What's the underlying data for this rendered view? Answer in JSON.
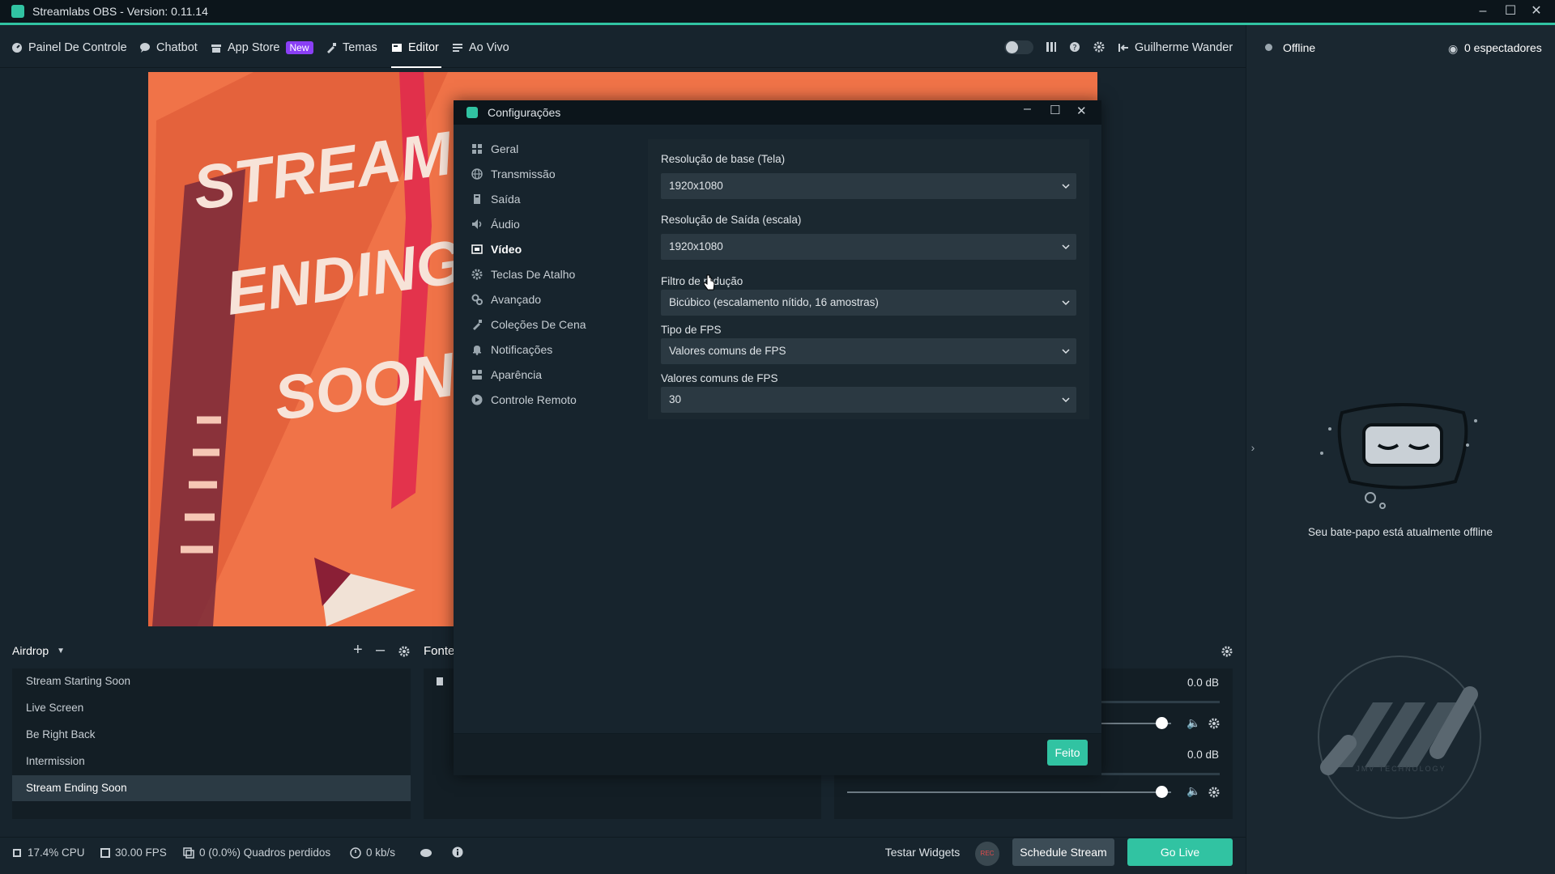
{
  "window": {
    "title": "Streamlabs OBS - Version: 0.11.14"
  },
  "nav": {
    "items": [
      {
        "label": "Painel De Controle"
      },
      {
        "label": "Chatbot"
      },
      {
        "label": "App Store",
        "badge": "New"
      },
      {
        "label": "Temas"
      },
      {
        "label": "Editor"
      },
      {
        "label": "Ao Vivo"
      }
    ],
    "user": "Guilherme Wander"
  },
  "chat": {
    "status": "Offline",
    "viewers": "0 espectadores",
    "offline_message": "Seu bate-papo está atualmente offline",
    "watermark_text": "JMV TECHNOLOGY"
  },
  "scenes": {
    "collection": "Airdrop",
    "items": [
      {
        "label": "Stream Starting Soon"
      },
      {
        "label": "Live Screen"
      },
      {
        "label": "Be Right Back"
      },
      {
        "label": "Intermission"
      },
      {
        "label": "Stream Ending Soon"
      }
    ],
    "active_index": 4
  },
  "sources": {
    "header": "Fonte"
  },
  "mixer": {
    "channels": [
      {
        "db": "0.0 dB",
        "level": 0.97
      },
      {
        "db": "0.0 dB",
        "level": 0.97
      }
    ]
  },
  "status": {
    "cpu": "17.4% CPU",
    "fps": "30.00 FPS",
    "frames": "0 (0.0%) Quadros perdidos",
    "bitrate": "0 kb/s"
  },
  "actions": {
    "test_widgets": "Testar Widgets",
    "rec": "REC",
    "schedule": "Schedule Stream",
    "go_live": "Go Live"
  },
  "preview": {
    "lines": [
      "STREAM",
      "ENDING",
      "SOON"
    ]
  },
  "settings": {
    "title": "Configurações",
    "nav": [
      {
        "label": "Geral",
        "icon": "grid-icon"
      },
      {
        "label": "Transmissão",
        "icon": "globe-icon"
      },
      {
        "label": "Saída",
        "icon": "output-icon"
      },
      {
        "label": "Áudio",
        "icon": "speaker-icon"
      },
      {
        "label": "Vídeo",
        "icon": "film-icon"
      },
      {
        "label": "Teclas De Atalho",
        "icon": "gear-icon"
      },
      {
        "label": "Avançado",
        "icon": "cogs-icon"
      },
      {
        "label": "Coleções De Cena",
        "icon": "brush-icon"
      },
      {
        "label": "Notificações",
        "icon": "bell-icon"
      },
      {
        "label": "Aparência",
        "icon": "blocks-icon"
      },
      {
        "label": "Controle Remoto",
        "icon": "play-icon"
      }
    ],
    "active_index": 4,
    "fields": [
      {
        "label": "Resolução de base (Tela)",
        "value": "1920x1080"
      },
      {
        "label": "Resolução de Saída (escala)",
        "value": "1920x1080"
      },
      {
        "label": "Filtro de redução",
        "value": "Bicúbico (escalamento nítido, 16 amostras)"
      },
      {
        "label": "Tipo de FPS",
        "value": "Valores comuns de FPS"
      },
      {
        "label": "Valores comuns de FPS",
        "value": "30"
      }
    ],
    "done": "Feito"
  },
  "colors": {
    "accent": "#31c3a2",
    "badge": "#8a3ff5",
    "preview_bg": "#f07247"
  }
}
